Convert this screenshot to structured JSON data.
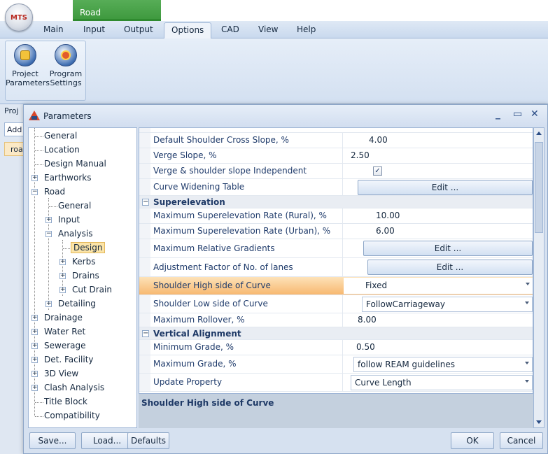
{
  "ribbon": {
    "context_tab": "Road",
    "tabs": [
      "Main",
      "Input",
      "Output",
      "Options",
      "CAD",
      "View",
      "Help"
    ],
    "active_tab": "Options",
    "buttons": [
      {
        "line1": "Project",
        "line2": "Parameters"
      },
      {
        "line1": "Program",
        "line2": "Settings"
      }
    ],
    "app_logo": "MTS"
  },
  "page": {
    "label": "Proj",
    "add_button": "Add",
    "item": "roa"
  },
  "dialog": {
    "title": "Parameters",
    "minimize": "_",
    "maximize": "▭",
    "close": "✕",
    "tree": [
      "General",
      "Location",
      "Design Manual",
      "Earthworks",
      "Road",
      "General",
      "Input",
      "Analysis",
      "Design",
      "Kerbs",
      "Drains",
      "Cut Drain",
      "Detailing",
      "Drainage",
      "Water Ret",
      "Sewerage",
      "Det. Facility",
      "3D View",
      "Clash Analysis",
      "Title Block",
      "Compatibility"
    ],
    "selected_tree_item": "Design",
    "grid": {
      "rows": [
        {
          "name": "Default Shoulder Cross Slope, %",
          "value": "4.00"
        },
        {
          "name": "Verge Slope, %",
          "value": "2.50"
        },
        {
          "name": "Verge & shoulder slope Independent",
          "value": "✓"
        },
        {
          "name": "Curve Widening Table",
          "value": "Edit ..."
        },
        {
          "category": "Superelevation",
          "toggle": "−"
        },
        {
          "name": "Maximum Superelevation Rate (Rural), %",
          "value": "10.00"
        },
        {
          "name": "Maximum Superelevation Rate (Urban), %",
          "value": "6.00"
        },
        {
          "name": "Maximum Relative Gradients",
          "value": "Edit ..."
        },
        {
          "name": "Adjustment Factor of No. of lanes",
          "value": "Edit ..."
        },
        {
          "name": "Shoulder High side of Curve",
          "value": "Fixed"
        },
        {
          "name": "Shoulder Low side of Curve",
          "value": "FollowCarriageway"
        },
        {
          "name": "Maximum Rollover, %",
          "value": "8.00"
        },
        {
          "category": "Vertical Alignment",
          "toggle": "−"
        },
        {
          "name": "Minimum Grade, %",
          "value": "0.50"
        },
        {
          "name": "Maximum Grade, %",
          "value": "follow REAM guidelines"
        },
        {
          "name": "Update Property",
          "value": "Curve Length"
        }
      ]
    },
    "description": "Shoulder High side of Curve",
    "buttons": {
      "save": "Save...",
      "load": "Load...",
      "defaults": "Defaults",
      "ok": "OK",
      "cancel": "Cancel"
    }
  },
  "colors": {
    "context_tab": "#3f9a3f",
    "highlight_row": "#f7b870",
    "selected_node": "#fbe4a8"
  }
}
